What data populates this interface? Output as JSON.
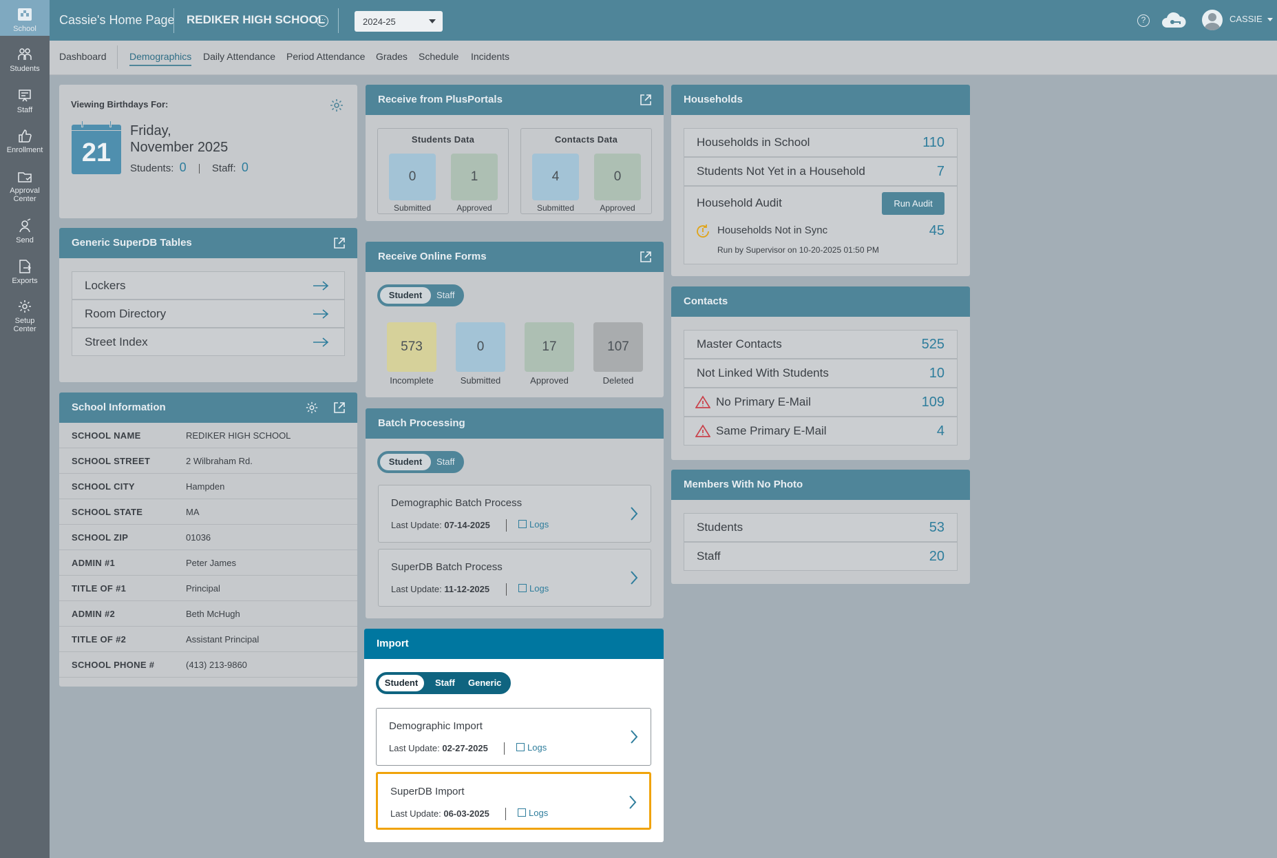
{
  "sidebar": {
    "items": [
      {
        "label": "School",
        "icon": "school-icon"
      },
      {
        "label": "Students",
        "icon": "students-icon"
      },
      {
        "label": "Staff",
        "icon": "staff-icon"
      },
      {
        "label": "Enrollment",
        "icon": "thumbs-up-icon"
      },
      {
        "label": "Approval",
        "label2": "Center",
        "icon": "folder-icon"
      },
      {
        "label": "Send",
        "icon": "send-icon"
      },
      {
        "label": "Exports",
        "icon": "export-icon"
      },
      {
        "label": "Setup",
        "label2": "Center",
        "icon": "gear-icon"
      }
    ]
  },
  "header": {
    "page_title": "Cassie's Home Page",
    "school_name": "REDIKER HIGH SCHOOL",
    "year_selected": "2024-25",
    "user_name": "CASSIE"
  },
  "subnav": {
    "tabs": [
      "Dashboard",
      "Demographics",
      "Daily Attendance",
      "Period Attendance",
      "Grades",
      "Schedule",
      "Incidents"
    ],
    "active": "Demographics"
  },
  "birthdays": {
    "heading": "Viewing Birthdays For:",
    "day_number": "21",
    "day_line1": "Friday,",
    "day_line2": "November 2025",
    "students_label": "Students:",
    "students_count": "0",
    "staff_label": "Staff:",
    "staff_count": "0"
  },
  "superdb_tables": {
    "title": "Generic SuperDB Tables",
    "items": [
      "Lockers",
      "Room Directory",
      "Street Index"
    ]
  },
  "school_info": {
    "title": "School Information",
    "rows": [
      {
        "key": "SCHOOL NAME",
        "value": "REDIKER HIGH SCHOOL"
      },
      {
        "key": "SCHOOL STREET",
        "value": "2 Wilbraham Rd."
      },
      {
        "key": "SCHOOL CITY",
        "value": "Hampden"
      },
      {
        "key": "SCHOOL STATE",
        "value": "MA"
      },
      {
        "key": "SCHOOL ZIP",
        "value": "01036"
      },
      {
        "key": "ADMIN #1",
        "value": "Peter James"
      },
      {
        "key": "TITLE OF #1",
        "value": "Principal"
      },
      {
        "key": "ADMIN #2",
        "value": "Beth McHugh"
      },
      {
        "key": "TITLE OF #2",
        "value": "Assistant Principal"
      },
      {
        "key": "SCHOOL PHONE #",
        "value": "(413) 213-9860"
      }
    ]
  },
  "plusportals": {
    "title": "Receive from PlusPortals",
    "students": {
      "title": "Students Data",
      "submitted": "0",
      "approved": "1"
    },
    "contacts": {
      "title": "Contacts Data",
      "submitted": "4",
      "approved": "0"
    },
    "submitted_label": "Submitted",
    "approved_label": "Approved"
  },
  "online_forms": {
    "title": "Receive Online Forms",
    "toggle": {
      "on": "Student",
      "off": "Staff"
    },
    "stats": [
      {
        "value": "573",
        "label": "Incomplete",
        "color": "#d6d19a"
      },
      {
        "value": "0",
        "label": "Submitted",
        "color": "#a3c3d6"
      },
      {
        "value": "17",
        "label": "Approved",
        "color": "#adbfb3"
      },
      {
        "value": "107",
        "label": "Deleted",
        "color": "#a9acae"
      }
    ]
  },
  "batch": {
    "title": "Batch Processing",
    "toggle": {
      "on": "Student",
      "off": "Staff"
    },
    "items": [
      {
        "title": "Demographic Batch Process",
        "update_label": "Last Update:",
        "date": "07-14-2025",
        "logs": "Logs"
      },
      {
        "title": "SuperDB Batch Process",
        "update_label": "Last Update:",
        "date": "11-12-2025",
        "logs": "Logs"
      }
    ]
  },
  "import": {
    "title": "Import",
    "toggle": {
      "on": "Student",
      "off1": "Staff",
      "off2": "Generic"
    },
    "items": [
      {
        "title": "Demographic Import",
        "update_label": "Last Update:",
        "date": "02-27-2025",
        "logs": "Logs"
      },
      {
        "title": "SuperDB Import",
        "update_label": "Last Update:",
        "date": "06-03-2025",
        "logs": "Logs"
      }
    ]
  },
  "households": {
    "title": "Households",
    "rows": [
      {
        "label": "Households in School",
        "value": "110"
      },
      {
        "label": "Students Not Yet in a Household",
        "value": "7"
      }
    ],
    "audit_label": "Household Audit",
    "run_audit": "Run Audit",
    "sync_label": "Households Not in Sync",
    "sync_value": "45",
    "run_by_prefix": "Run by Supervisor on",
    "run_by_date": "10-20-2025 01:50 PM"
  },
  "contacts": {
    "title": "Contacts",
    "rows": [
      {
        "label": "Master Contacts",
        "value": "525"
      },
      {
        "label": "Not Linked With Students",
        "value": "10"
      },
      {
        "label": "No Primary E-Mail",
        "value": "109"
      },
      {
        "label": "Same Primary E-Mail",
        "value": "4"
      }
    ]
  },
  "no_photo": {
    "title": "Members With No Photo",
    "rows": [
      {
        "label": "Students",
        "value": "53"
      },
      {
        "label": "Staff",
        "value": "20"
      }
    ]
  },
  "colors": {
    "accent": "#4f8599",
    "highlight": "#f0a30a",
    "link": "#2e7d9c",
    "import_head": "#0077a0"
  }
}
